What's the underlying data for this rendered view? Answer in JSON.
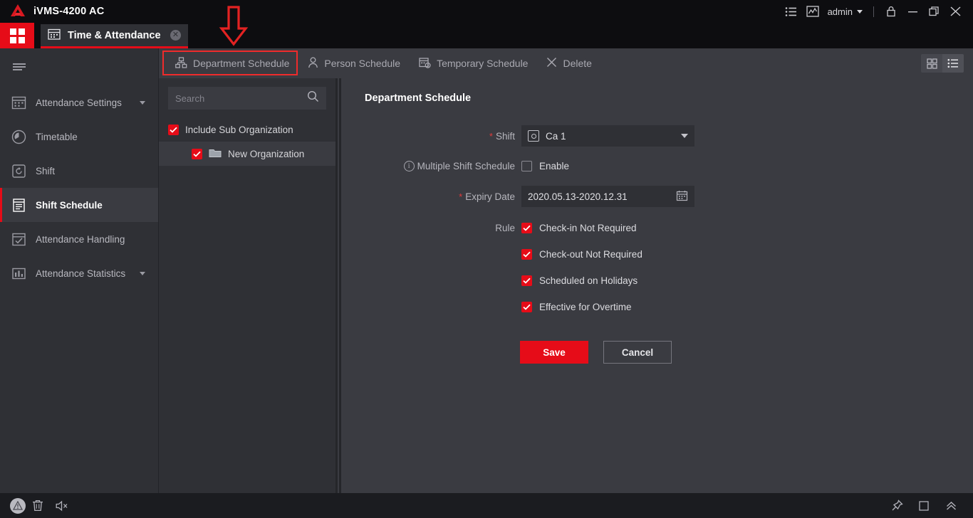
{
  "window": {
    "app_title": "iVMS-4200 AC",
    "logo_icon": "hikvision-logo-icon",
    "controls": [
      {
        "name": "list-view-icon",
        "label": ""
      },
      {
        "name": "statistics-icon",
        "label": ""
      }
    ],
    "user": "admin",
    "lock_icon": "lock-icon",
    "minimize_icon": "minimize-icon",
    "maximize_icon": "maximize-icon",
    "close_icon": "close-icon"
  },
  "tabbar": {
    "home_icon": "home-grid-icon",
    "tab": {
      "icon": "calendar-icon",
      "label": "Time & Attendance",
      "close_label": "✕"
    }
  },
  "annotation": {
    "arrow": "red-down-arrow",
    "highlight_box": "red-highlight-box",
    "accent_color": "#ef2b2b"
  },
  "sidebar": {
    "menu_icon": "hamburger-icon",
    "items": [
      {
        "label": "Attendance Settings",
        "icon": "calendar-settings-icon",
        "expandable": true,
        "active": false
      },
      {
        "label": "Timetable",
        "icon": "clock-icon",
        "expandable": false,
        "active": false
      },
      {
        "label": "Shift",
        "icon": "shift-icon",
        "expandable": false,
        "active": false
      },
      {
        "label": "Shift Schedule",
        "icon": "schedule-list-icon",
        "expandable": false,
        "active": true
      },
      {
        "label": "Attendance Handling",
        "icon": "check-calendar-icon",
        "expandable": false,
        "active": false
      },
      {
        "label": "Attendance Statistics",
        "icon": "bar-chart-icon",
        "expandable": true,
        "active": false
      }
    ]
  },
  "toolbar": {
    "buttons": [
      {
        "label": "Department Schedule",
        "icon": "org-chart-icon",
        "highlighted": true
      },
      {
        "label": "Person Schedule",
        "icon": "person-icon",
        "highlighted": false
      },
      {
        "label": "Temporary Schedule",
        "icon": "calendar-clock-icon",
        "highlighted": false
      },
      {
        "label": "Delete",
        "icon": "close-x-icon",
        "highlighted": false
      }
    ],
    "view_grid_icon": "grid-view-icon",
    "view_list_icon": "list-view-icon",
    "selected_view": "list"
  },
  "tree": {
    "search_placeholder": "Search",
    "search_value": "",
    "search_icon": "search-icon",
    "include_sub_org": {
      "label": "Include Sub Organization",
      "checked": true
    },
    "nodes": [
      {
        "label": "New Organization",
        "checked": true,
        "icon": "folder-icon",
        "selected": true
      }
    ]
  },
  "form": {
    "title": "Department Schedule",
    "shift": {
      "label": "Shift",
      "required": true,
      "value": "Ca 1",
      "icon": "shift-badge-icon",
      "caret_icon": "chevron-down-icon"
    },
    "multiple_shift": {
      "label": "Multiple Shift Schedule",
      "info_icon": "info-icon",
      "checkbox_label": "Enable",
      "checked": false
    },
    "expiry_date": {
      "label": "Expiry Date",
      "required": true,
      "value": "2020.05.13-2020.12.31",
      "icon": "calendar-icon"
    },
    "rule": {
      "label": "Rule",
      "options": [
        {
          "label": "Check-in Not Required",
          "checked": true
        },
        {
          "label": "Check-out Not Required",
          "checked": true
        },
        {
          "label": "Scheduled on Holidays",
          "checked": true
        },
        {
          "label": "Effective for Overtime",
          "checked": true
        }
      ]
    },
    "save_label": "Save",
    "cancel_label": "Cancel"
  },
  "statusbar": {
    "left_icons": [
      {
        "name": "warning-icon"
      },
      {
        "name": "trash-icon"
      },
      {
        "name": "mute-icon"
      }
    ],
    "right_icons": [
      {
        "name": "pin-icon"
      },
      {
        "name": "window-icon"
      },
      {
        "name": "chevron-up-icon"
      }
    ]
  },
  "colors": {
    "accent": "#e60c18",
    "panel": "#3a3b41",
    "sidebar": "#2f3035",
    "titlebar": "#0d0d10",
    "annotation": "#ef2b2b"
  }
}
